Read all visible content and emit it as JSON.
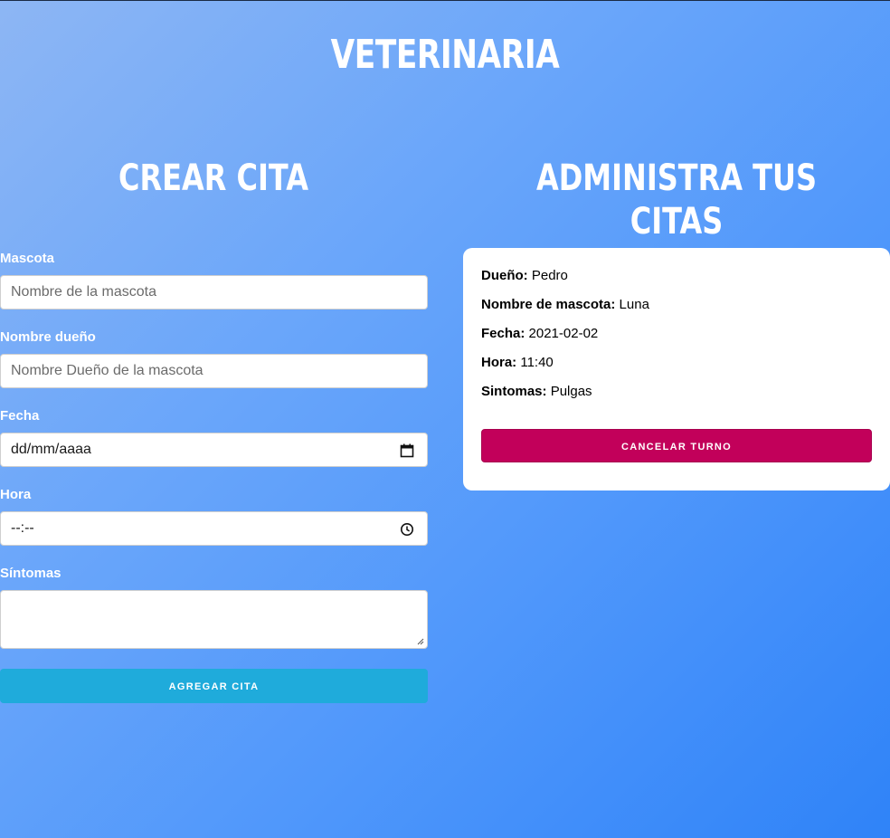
{
  "header": {
    "title": "VETERINARIA"
  },
  "create_section": {
    "title": "CREAR CITA",
    "fields": {
      "pet_label": "Mascota",
      "pet_placeholder": "Nombre de la mascota",
      "owner_label": "Nombre dueño",
      "owner_placeholder": "Nombre Dueño de la mascota",
      "date_label": "Fecha",
      "date_value": "dd/mm/aaaa",
      "time_label": "Hora",
      "time_value": "--:--",
      "symptoms_label": "Síntomas",
      "symptoms_value": ""
    },
    "submit_label": "AGREGAR CITA"
  },
  "manage_section": {
    "title": "ADMINISTRA TUS CITAS",
    "appointment": {
      "owner_key": "Dueño:",
      "owner_value": "Pedro",
      "pet_key": "Nombre de mascota:",
      "pet_value": "Luna",
      "date_key": "Fecha:",
      "date_value": "2021-02-02",
      "time_key": "Hora:",
      "time_value": "11:40",
      "symptoms_key": "Sintomas:",
      "symptoms_value": "Pulgas"
    },
    "cancel_label": "CANCELAR TURNO"
  },
  "colors": {
    "add_button": "#1fabdb",
    "cancel_button": "#c2005a",
    "background_start": "#8db6f4",
    "background_end": "#2f83f8"
  },
  "icons": {
    "date": "calendar-icon",
    "time": "clock-icon"
  }
}
